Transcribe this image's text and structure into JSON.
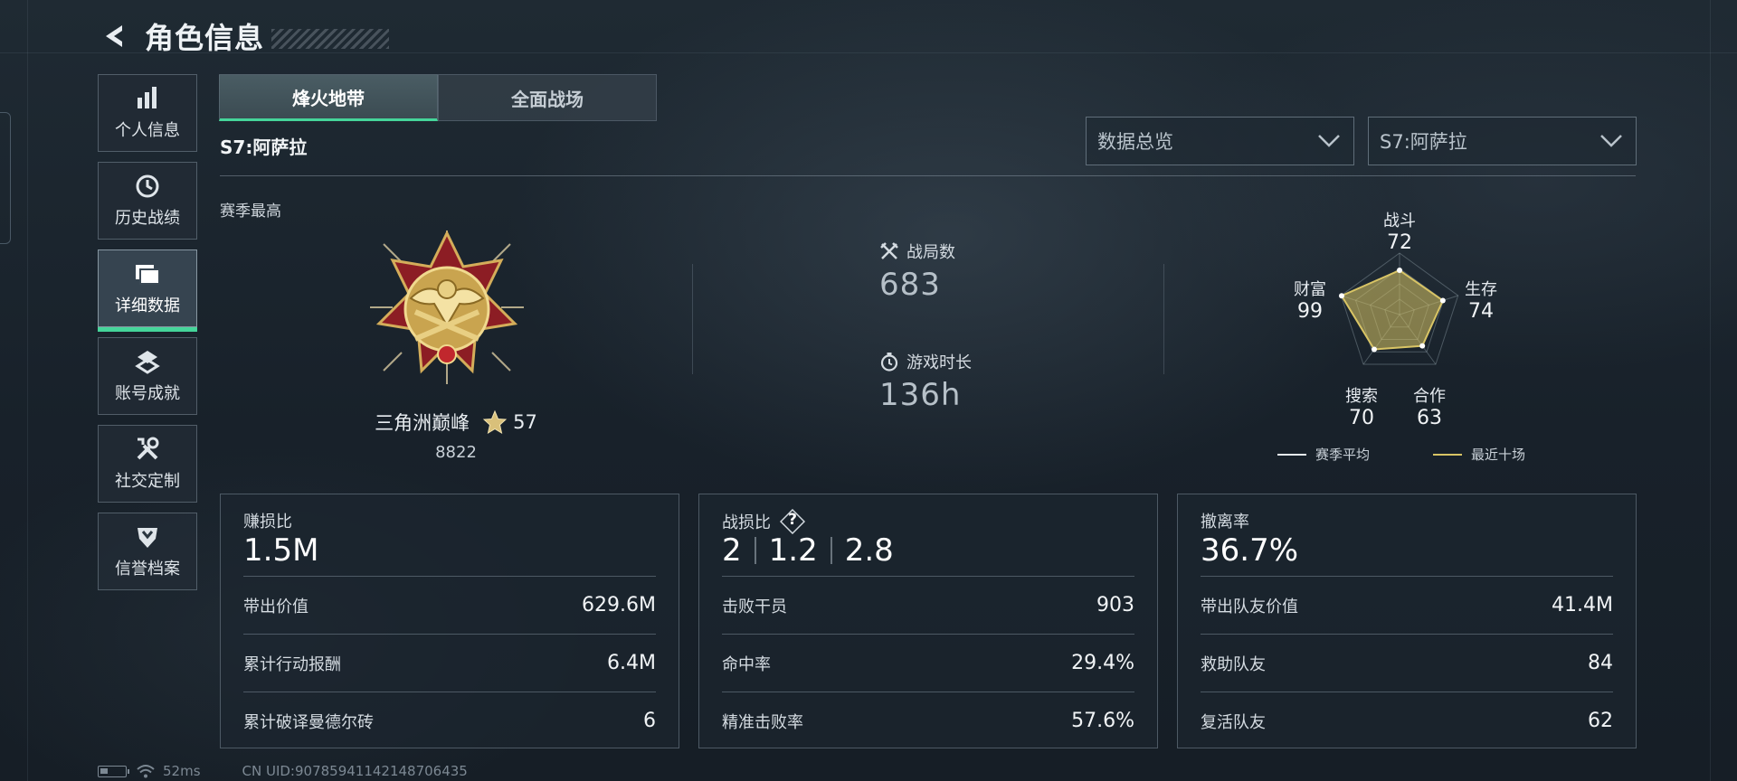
{
  "header": {
    "title": "角色信息"
  },
  "sidebar": {
    "items": [
      {
        "label": "个人信息",
        "icon": "bar-chart-icon"
      },
      {
        "label": "历史战绩",
        "icon": "history-icon"
      },
      {
        "label": "详细数据",
        "icon": "folder-icon",
        "active": true
      },
      {
        "label": "账号成就",
        "icon": "achievement-icon"
      },
      {
        "label": "社交定制",
        "icon": "tools-icon"
      },
      {
        "label": "信誉档案",
        "icon": "shield-icon"
      }
    ]
  },
  "tabs": [
    {
      "label": "烽火地带",
      "active": true
    },
    {
      "label": "全面战场",
      "active": false
    }
  ],
  "season_label": "S7:阿萨拉",
  "filters": {
    "view": "数据总览",
    "season": "S7:阿萨拉"
  },
  "season_best": {
    "label": "赛季最高",
    "rank_name": "三角洲巅峰",
    "stars": "57",
    "score": "8822"
  },
  "stats": {
    "matches": {
      "label": "战局数",
      "value": "683"
    },
    "playtime": {
      "label": "游戏时长",
      "value": "136h"
    }
  },
  "radar": {
    "axes": [
      {
        "label": "战斗",
        "value": 72
      },
      {
        "label": "生存",
        "value": 74
      },
      {
        "label": "合作",
        "value": 63
      },
      {
        "label": "搜索",
        "value": 70
      },
      {
        "label": "财富",
        "value": 99
      }
    ],
    "legend": [
      {
        "label": "赛季平均",
        "color": "#e6ebf0"
      },
      {
        "label": "最近十场",
        "color": "#d8c465"
      }
    ]
  },
  "cards": {
    "profit": {
      "label": "赚损比",
      "main": "1.5M",
      "rows": [
        {
          "label": "带出价值",
          "value": "629.6M"
        },
        {
          "label": "累计行动报酬",
          "value": "6.4M"
        },
        {
          "label": "累计破译曼德尔砖",
          "value": "6"
        }
      ]
    },
    "kd": {
      "label": "战损比",
      "help": "?",
      "values": [
        "2",
        "1.2",
        "2.8"
      ],
      "rows": [
        {
          "label": "击败干员",
          "value": "903"
        },
        {
          "label": "命中率",
          "value": "29.4%"
        },
        {
          "label": "精准击败率",
          "value": "57.6%"
        }
      ]
    },
    "extract": {
      "label": "撤离率",
      "main": "36.7%",
      "rows": [
        {
          "label": "带出队友价值",
          "value": "41.4M"
        },
        {
          "label": "救助队友",
          "value": "84"
        },
        {
          "label": "复活队友",
          "value": "62"
        }
      ]
    }
  },
  "footer": {
    "ping": "52ms",
    "uid": "CN UID:9078594114214870643​5"
  },
  "colors": {
    "accent": "#45d59a",
    "recent_series": "#d8c465"
  }
}
